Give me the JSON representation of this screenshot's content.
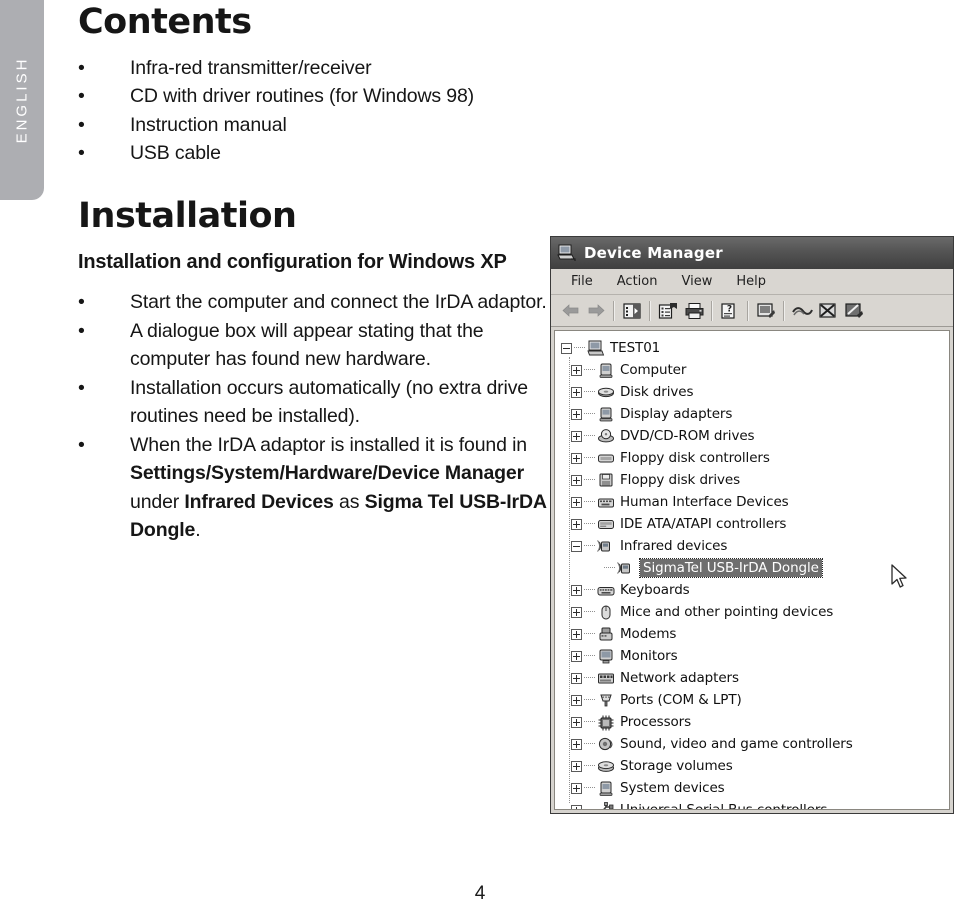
{
  "sidebar": {
    "language_tab": "ENGLISH",
    "tab_color": "#adaeb2"
  },
  "document": {
    "page_number": "4",
    "contents": {
      "heading": "Contents",
      "bullets": [
        "Infra-red transmitter/receiver",
        "CD with driver routines (for Windows 98)",
        "Instruction manual",
        "USB cable"
      ]
    },
    "installation": {
      "heading": "Installation",
      "subheading": "Installation and configuration for Windows XP",
      "bullets": [
        {
          "segments": [
            {
              "text": "Start the computer and connect the IrDA adaptor.",
              "bold": false
            }
          ]
        },
        {
          "segments": [
            {
              "text": "A dialogue box will appear stating that the computer has found new hardware.",
              "bold": false
            }
          ]
        },
        {
          "segments": [
            {
              "text": "Installation occurs automatically (no extra drive routines need be installed).",
              "bold": false
            }
          ]
        },
        {
          "segments": [
            {
              "text": "When the IrDA adaptor is installed it is found in ",
              "bold": false
            },
            {
              "text": "Settings/System/Hardware/Device Manager",
              "bold": true
            },
            {
              "text": " under ",
              "bold": false
            },
            {
              "text": "Infrared Devices",
              "bold": true
            },
            {
              "text": " as ",
              "bold": false
            },
            {
              "text": "Sigma Tel USB-IrDA Dongle",
              "bold": true
            },
            {
              "text": ".",
              "bold": false
            }
          ]
        }
      ]
    }
  },
  "device_manager": {
    "title": "Device Manager",
    "title_icon": "computer-icon",
    "menu": [
      {
        "label": "File"
      },
      {
        "label": "Action"
      },
      {
        "label": "View"
      },
      {
        "label": "Help"
      }
    ],
    "toolbar": [
      {
        "name": "back-arrow-icon"
      },
      {
        "name": "forward-arrow-icon"
      },
      {
        "name": "separator"
      },
      {
        "name": "show-hide-console-tree-icon"
      },
      {
        "name": "separator"
      },
      {
        "name": "properties-icon"
      },
      {
        "name": "print-icon"
      },
      {
        "name": "separator"
      },
      {
        "name": "help-icon"
      },
      {
        "name": "separator"
      },
      {
        "name": "scan-for-hardware-changes-icon"
      },
      {
        "name": "separator"
      },
      {
        "name": "update-driver-icon"
      },
      {
        "name": "disable-device-icon"
      },
      {
        "name": "uninstall-device-icon"
      }
    ],
    "tree": {
      "root": {
        "label": "TEST01",
        "expanded": true,
        "icon": "computer-icon"
      },
      "nodes": [
        {
          "label": "Computer",
          "expanded": false,
          "icon": "computer-node-icon"
        },
        {
          "label": "Disk drives",
          "expanded": false,
          "icon": "disk-drive-icon"
        },
        {
          "label": "Display adapters",
          "expanded": false,
          "icon": "display-adapter-icon"
        },
        {
          "label": "DVD/CD-ROM drives",
          "expanded": false,
          "icon": "dvd-drive-icon"
        },
        {
          "label": "Floppy disk controllers",
          "expanded": false,
          "icon": "floppy-controller-icon"
        },
        {
          "label": "Floppy disk drives",
          "expanded": false,
          "icon": "floppy-drive-icon"
        },
        {
          "label": "Human Interface Devices",
          "expanded": false,
          "icon": "hid-icon"
        },
        {
          "label": "IDE ATA/ATAPI controllers",
          "expanded": false,
          "icon": "ide-controller-icon"
        },
        {
          "label": "Infrared devices",
          "expanded": true,
          "icon": "infrared-device-icon",
          "children": [
            {
              "label": "SigmaTel USB-IrDA Dongle",
              "selected": true,
              "icon": "infrared-device-icon"
            }
          ]
        },
        {
          "label": "Keyboards",
          "expanded": false,
          "icon": "keyboard-icon"
        },
        {
          "label": "Mice and other pointing devices",
          "expanded": false,
          "icon": "mouse-icon"
        },
        {
          "label": "Modems",
          "expanded": false,
          "icon": "modem-icon"
        },
        {
          "label": "Monitors",
          "expanded": false,
          "icon": "monitor-icon"
        },
        {
          "label": "Network adapters",
          "expanded": false,
          "icon": "network-adapter-icon"
        },
        {
          "label": "Ports (COM & LPT)",
          "expanded": false,
          "icon": "port-icon"
        },
        {
          "label": "Processors",
          "expanded": false,
          "icon": "processor-icon"
        },
        {
          "label": "Sound, video and game controllers",
          "expanded": false,
          "icon": "sound-controller-icon"
        },
        {
          "label": "Storage volumes",
          "expanded": false,
          "icon": "storage-volume-icon"
        },
        {
          "label": "System devices",
          "expanded": false,
          "icon": "system-device-icon"
        },
        {
          "label": "Universal Serial Bus controllers",
          "expanded": false,
          "icon": "usb-controller-icon"
        }
      ]
    }
  }
}
